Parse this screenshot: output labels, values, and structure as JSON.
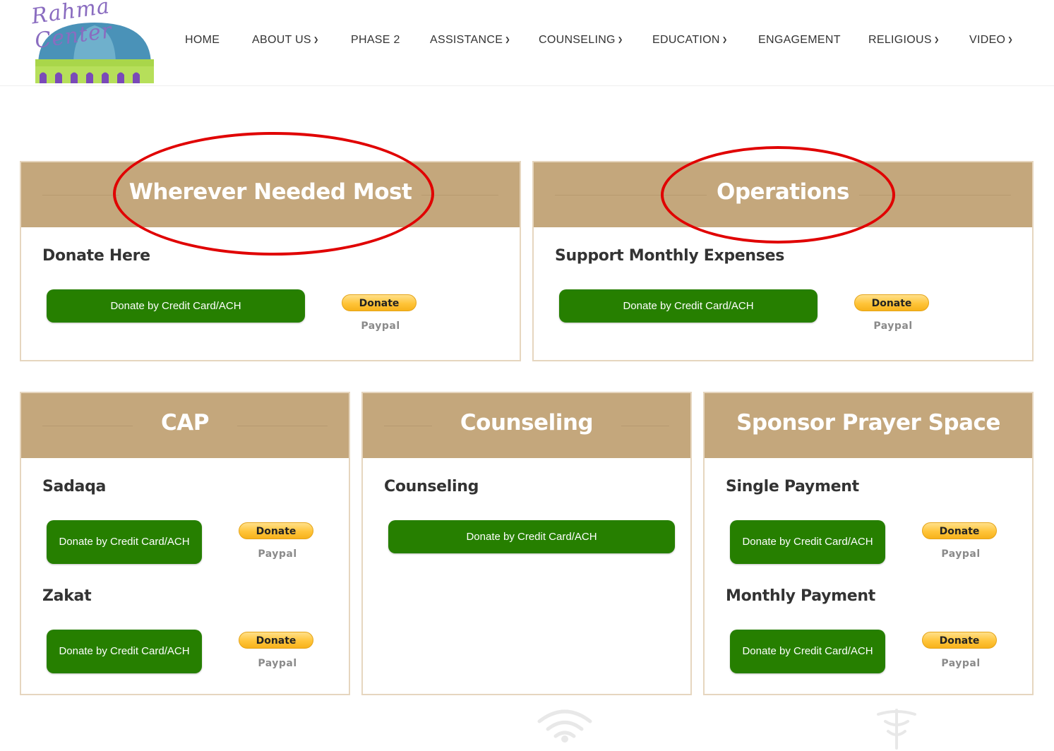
{
  "logo": {
    "script_text": "Rahma Center"
  },
  "nav": [
    {
      "label": "HOME",
      "dropdown": false
    },
    {
      "label": "ABOUT US",
      "dropdown": true
    },
    {
      "label": "PHASE 2",
      "dropdown": false
    },
    {
      "label": "ASSISTANCE",
      "dropdown": true
    },
    {
      "label": "COUNSELING",
      "dropdown": true
    },
    {
      "label": "EDUCATION",
      "dropdown": true
    },
    {
      "label": "ENGAGEMENT",
      "dropdown": false
    },
    {
      "label": "RELIGIOUS",
      "dropdown": true
    },
    {
      "label": "VIDEO",
      "dropdown": true
    }
  ],
  "cards": {
    "wherever": {
      "title": "Wherever Needed Most",
      "section": "Donate Here",
      "credit": "Donate by Credit Card/ACH",
      "donate": "Donate",
      "paypal": "Paypal"
    },
    "operations": {
      "title": "Operations",
      "section": "Support Monthly Expenses",
      "credit": "Donate by Credit Card/ACH",
      "donate": "Donate",
      "paypal": "Paypal"
    },
    "cap": {
      "title": "CAP",
      "section1": "Sadaqa",
      "section2": "Zakat",
      "credit": "Donate by Credit Card/ACH",
      "donate": "Donate",
      "paypal": "Paypal"
    },
    "counseling": {
      "title": "Counseling",
      "section": "Counseling",
      "credit": "Donate by Credit Card/ACH"
    },
    "sponsor": {
      "title": "Sponsor Prayer Space",
      "section1": "Single Payment",
      "section2": "Monthly Payment",
      "credit": "Donate by Credit Card/ACH",
      "donate": "Donate",
      "paypal": "Paypal"
    }
  },
  "colors": {
    "header_band": "#c4a77c",
    "green_button": "#267f00",
    "paypal_yellow": "#ffc439",
    "highlight_ellipse": "#e00000"
  }
}
